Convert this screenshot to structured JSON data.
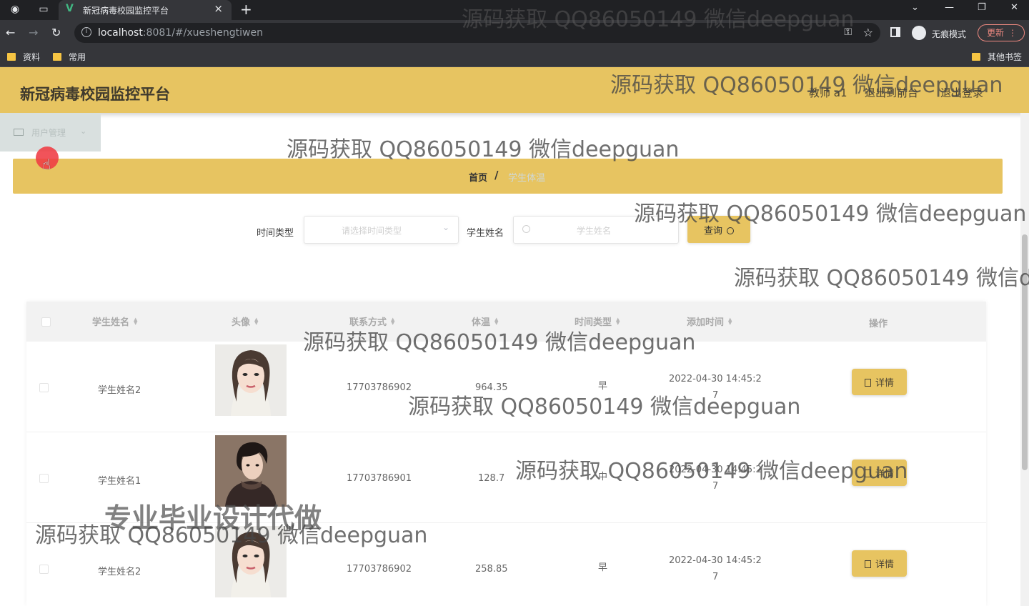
{
  "browser": {
    "tab_title": "新冠病毒校园监控平台",
    "tab_close": "×",
    "new_tab": "+",
    "url_host": "localhost",
    "url_rest": ":8081/#/xueshengtiwen",
    "incognito_label": "无痕模式",
    "update_label": "更新",
    "bookmarks": [
      "资料",
      "常用"
    ],
    "other_bookmarks": "其他书签"
  },
  "app": {
    "title": "新冠病毒校园监控平台",
    "user_role": "教师 a1",
    "back_to_front": "退出到前台",
    "logout": "退出登录"
  },
  "sidebar": {
    "items": [
      {
        "label": "用户管理",
        "icon": "mail-icon"
      }
    ]
  },
  "breadcrumb": {
    "home": "首页",
    "separator": "/",
    "current": "学生体温"
  },
  "filters": {
    "time_type_label": "时间类型",
    "time_type_placeholder": "请选择时间类型",
    "student_name_label": "学生姓名",
    "student_name_placeholder": "学生姓名",
    "query_button": "查询"
  },
  "table": {
    "columns": [
      "学生姓名",
      "头像",
      "联系方式",
      "体温",
      "时间类型",
      "添加时间",
      "操作"
    ],
    "rows": [
      {
        "name": "学生姓名2",
        "avatar": "female-portrait",
        "contact": "17703786902",
        "temp": "964.35",
        "time_type": "早",
        "added_line1": "2022-04-30 14:45:2",
        "added_line2": "7",
        "action": "详情"
      },
      {
        "name": "学生姓名1",
        "avatar": "male-portrait",
        "contact": "17703786901",
        "temp": "128.7",
        "time_type": "中",
        "added_line1": "2022-04-30 14:45:2",
        "added_line2": "7",
        "action": "详情"
      },
      {
        "name": "学生姓名2",
        "avatar": "female-portrait",
        "contact": "17703786902",
        "temp": "258.85",
        "time_type": "早",
        "added_line1": "2022-04-30 14:45:2",
        "added_line2": "7",
        "action": "详情"
      }
    ]
  },
  "watermarks": {
    "source": "源码获取 QQ86050149 微信deepguan",
    "source_cut": "源码获取 QQ86050149 微信de",
    "promo": "专业毕业设计代做"
  },
  "colors": {
    "accent": "#e7c461",
    "browser_dark": "#202124",
    "sidebar": "#d9e0df"
  }
}
